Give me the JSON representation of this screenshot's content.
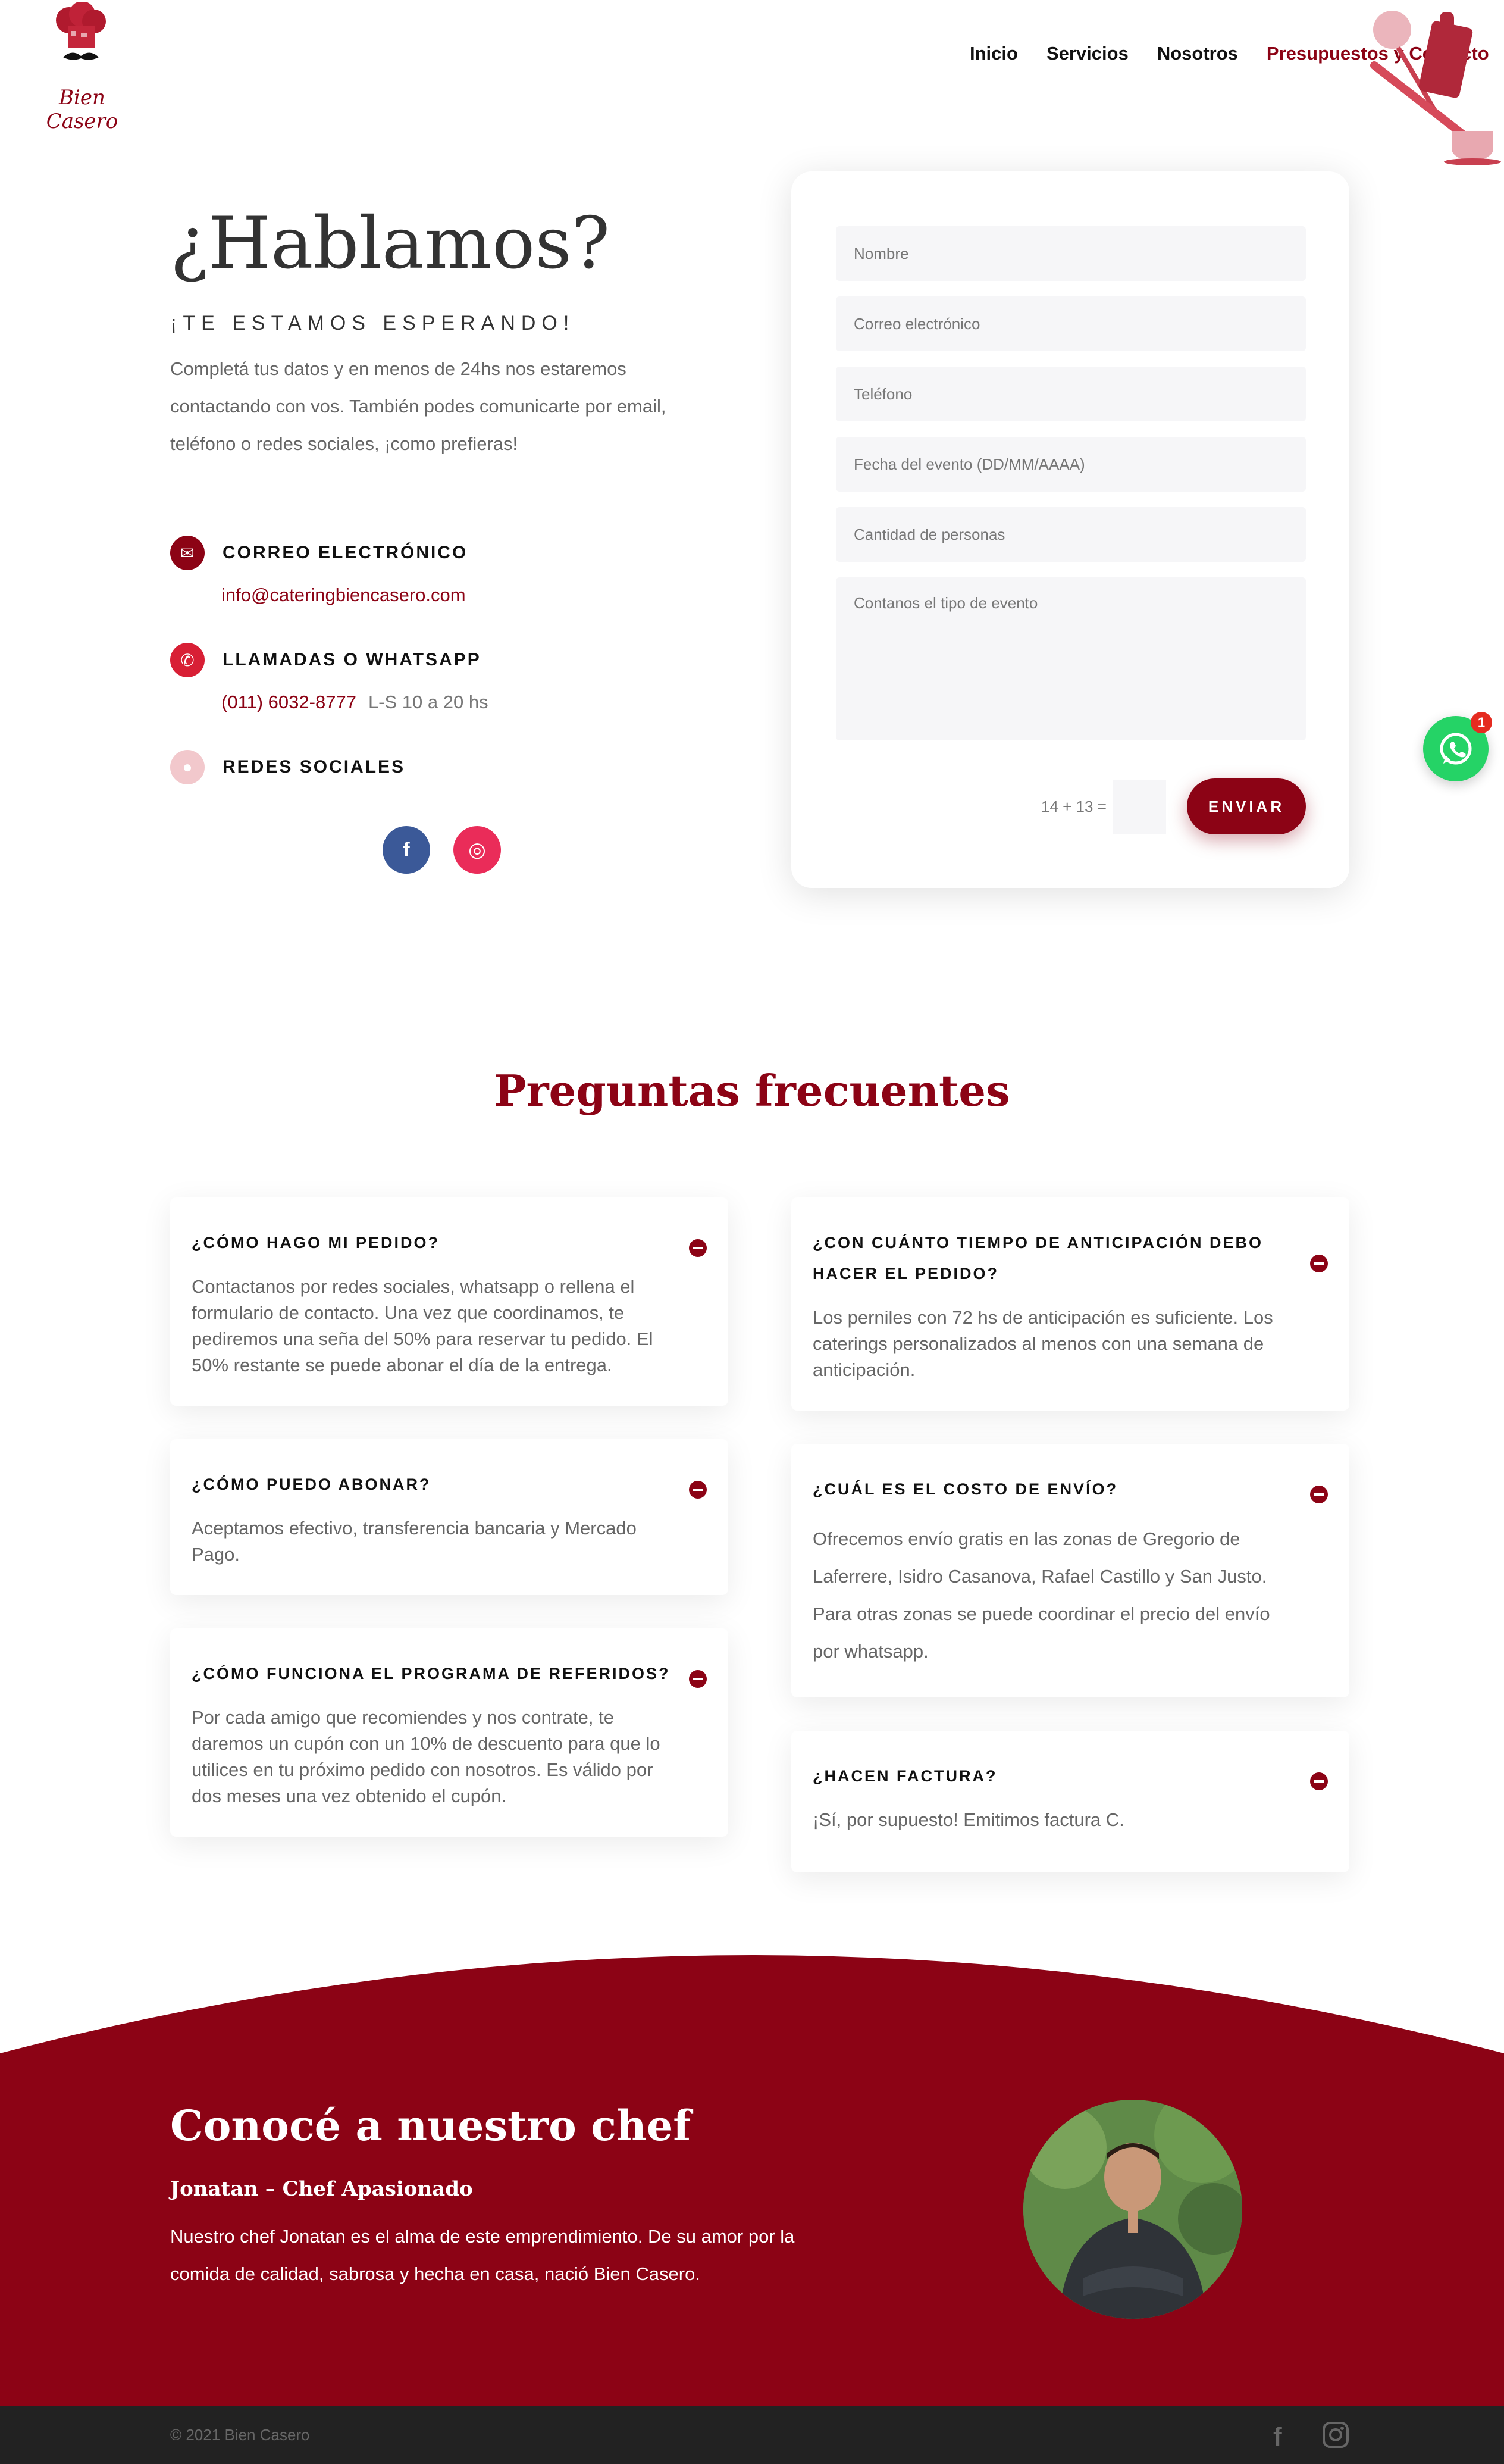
{
  "header": {
    "logo_text": "Bien Casero",
    "nav": [
      {
        "label": "Inicio",
        "active": false
      },
      {
        "label": "Servicios",
        "active": false
      },
      {
        "label": "Nosotros",
        "active": false
      },
      {
        "label": "Presupuestos y Contacto",
        "active": true
      }
    ]
  },
  "contact": {
    "title": "¿Hablamos?",
    "subtitle": "¡TE ESTAMOS ESPERANDO!",
    "intro": "Completá tus datos y en menos de 24hs nos estaremos contactando con vos. También podes comunicarte por email, teléfono o redes sociales, ¡como prefieras!",
    "email_title": "CORREO ELECTRÓNICO",
    "email_value": "info@cateringbiencasero.com",
    "phone_title": "LLAMADAS O WHATSAPP",
    "phone_value": "(011) 6032-8777",
    "phone_hours": "L-S 10 a 20 hs",
    "social_title": "REDES SOCIALES",
    "social": [
      {
        "icon": "facebook-icon",
        "glyph": "f",
        "color": "#3b5998"
      },
      {
        "icon": "instagram-icon",
        "glyph": "◎",
        "color": "#ea2c59"
      }
    ]
  },
  "form": {
    "name_placeholder": "Nombre",
    "email_placeholder": "Correo electrónico",
    "phone_placeholder": "Teléfono",
    "date_placeholder": "Fecha del evento (DD/MM/AAAA)",
    "people_placeholder": "Cantidad de personas",
    "message_placeholder": "Contanos el tipo de evento",
    "captcha": "14 + 13 =",
    "submit": "ENVIAR"
  },
  "whatsapp": {
    "badge": "1"
  },
  "faq": {
    "title": "Preguntas frecuentes",
    "items": [
      {
        "q": "¿CÓMO HAGO MI PEDIDO?",
        "a": "Contactanos por redes sociales, whatsapp o rellena el formulario de contacto. Una vez que coordinamos, te pediremos una seña del 50% para reservar tu pedido. El 50% restante se puede abonar el día de la entrega."
      },
      {
        "q": "¿CÓMO PUEDO ABONAR?",
        "a": "Aceptamos efectivo, transferencia bancaria y Mercado Pago."
      },
      {
        "q": "¿CÓMO FUNCIONA EL PROGRAMA DE REFERIDOS?",
        "a": "Por cada amigo que recomiendes y nos contrate, te daremos un cupón con un 10% de descuento para que lo utilices en tu próximo pedido con nosotros. Es válido por dos meses una vez obtenido el cupón."
      },
      {
        "q": "¿CON CUÁNTO TIEMPO DE ANTICIPACIÓN DEBO HACER EL PEDIDO?",
        "a": "Los perniles con 72 hs de anticipación es suficiente. Los caterings personalizados al menos con una semana de anticipación."
      },
      {
        "q": "¿CUÁL ES EL COSTO DE ENVÍO?",
        "a": "Ofrecemos envío gratis en las zonas de Gregorio de Laferrere, Isidro Casanova, Rafael Castillo y San Justo. Para otras zonas se puede coordinar el precio del envío por whatsapp."
      },
      {
        "q": "¿HACEN FACTURA?",
        "a": "¡Sí, por supuesto! Emitimos factura C."
      }
    ]
  },
  "chef": {
    "title": "Conocé a nuestro chef",
    "subtitle": "Jonatan – Chef Apasionado",
    "text": "Nuestro chef Jonatan es el alma de este emprendimiento. De su amor por la comida de calidad, sabrosa y hecha en casa, nació Bien Casero."
  },
  "footer": {
    "copyright": "© 2021 Bien Casero",
    "icons": [
      "facebook-icon",
      "instagram-icon"
    ]
  },
  "colors": {
    "brand": "#8c0315",
    "whatsapp": "#25d366",
    "footer": "#222222"
  }
}
